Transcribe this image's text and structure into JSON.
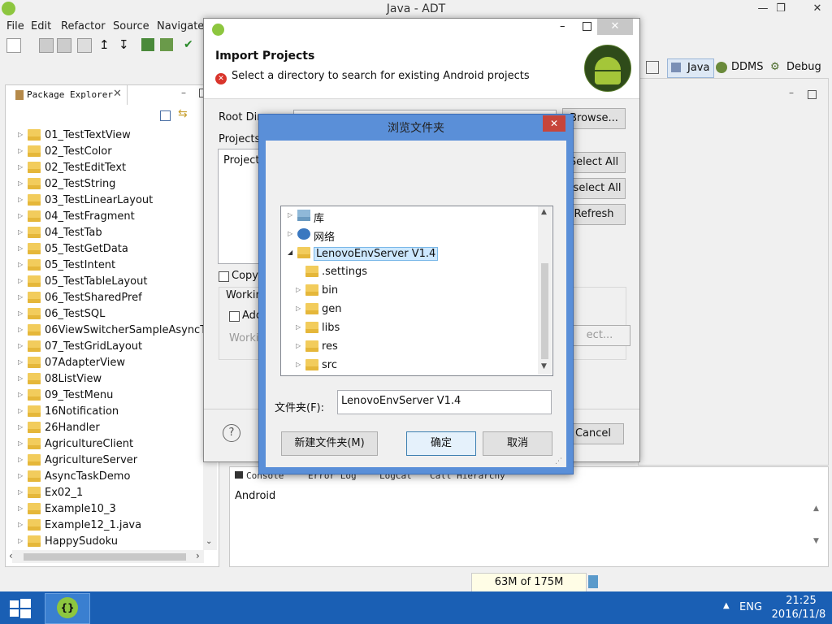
{
  "window": {
    "title": "Java - ADT"
  },
  "menu": [
    "File",
    "Edit",
    "Refactor",
    "Source",
    "Navigate"
  ],
  "perspectives": [
    {
      "label": "Java",
      "active": true
    },
    {
      "label": "DDMS",
      "active": false
    },
    {
      "label": "Debug",
      "active": false
    }
  ],
  "package_explorer": {
    "tab_label": "Package Explorer",
    "projects": [
      "01_TestTextView",
      "02_TestColor",
      "02_TestEditText",
      "02_TestString",
      "03_TestLinearLayout",
      "04_TestFragment",
      "04_TestTab",
      "05_TestGetData",
      "05_TestIntent",
      "05_TestTableLayout",
      "06_TestSharedPref",
      "06_TestSQL",
      "06ViewSwitcherSampleAsyncTask",
      "07_TestGridLayout",
      "07AdapterView",
      "08ListView",
      "09_TestMenu",
      "16Notification",
      "26Handler",
      "AgricultureClient",
      "AgricultureServer",
      "AsyncTaskDemo",
      "Ex02_1",
      "Example10_3",
      "Example12_1.java",
      "HappySudoku"
    ]
  },
  "import_dialog": {
    "heading": "Import Projects",
    "error": "Select a directory to search for existing Android projects",
    "root_label": "Root Dir",
    "projects_label": "Projects:",
    "col_project": "Project",
    "browse_btn": "Browse...",
    "select_all": "Select All",
    "deselect_all": "eselect All",
    "refresh": "Refresh",
    "copy_label": "Copy",
    "working_label": "Workin",
    "add_label": "Add",
    "working_sets": "Worki",
    "select_btn": "ect...",
    "cancel": "Cancel",
    "help": "?"
  },
  "browse_dialog": {
    "title": "浏览文件夹",
    "tree": [
      {
        "label": "库",
        "level": 0,
        "expander": "closed",
        "icon": "library-icon"
      },
      {
        "label": "网络",
        "level": 0,
        "expander": "closed",
        "icon": "network-icon"
      },
      {
        "label": "LenovoEnvServer V1.4",
        "level": 0,
        "expander": "open",
        "icon": "folder-icon",
        "selected": true
      },
      {
        "label": ".settings",
        "level": 1,
        "expander": "none",
        "icon": "folder-icon"
      },
      {
        "label": "bin",
        "level": 1,
        "expander": "closed",
        "icon": "folder-icon"
      },
      {
        "label": "gen",
        "level": 1,
        "expander": "closed",
        "icon": "folder-icon"
      },
      {
        "label": "libs",
        "level": 1,
        "expander": "closed",
        "icon": "folder-icon"
      },
      {
        "label": "res",
        "level": 1,
        "expander": "closed",
        "icon": "folder-icon"
      },
      {
        "label": "src",
        "level": 1,
        "expander": "closed",
        "icon": "folder-icon"
      }
    ],
    "folder_label": "文件夹(F):",
    "folder_value": "LenovoEnvServer V1.4",
    "new_folder_btn": "新建文件夹(M)",
    "ok_btn": "确定",
    "cancel_btn": "取消"
  },
  "console": {
    "tabs": [
      "Console",
      "Error Log",
      "LogCat",
      "Call Hierarchy"
    ],
    "text": "Android"
  },
  "status": {
    "memory": "63M of 175M"
  },
  "taskbar": {
    "lang": "ENG",
    "time": "21:25",
    "date": "2016/11/8"
  }
}
